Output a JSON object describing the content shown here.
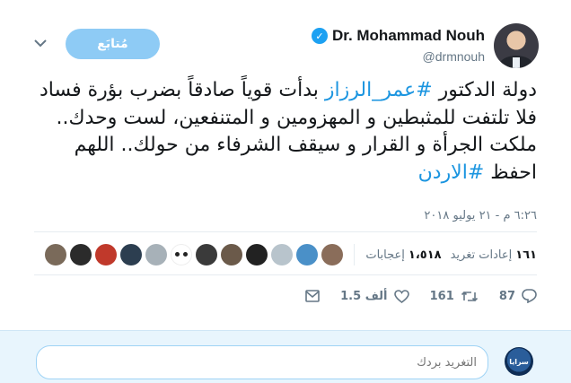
{
  "user": {
    "display_name": "Dr. Mohammad Nouh",
    "handle": "@drmnouh",
    "verified": true
  },
  "follow_button": {
    "label": "مُتابَع"
  },
  "tweet": {
    "text_parts": [
      {
        "text": "دولة الدكتور ",
        "type": "text"
      },
      {
        "text": "#عمر_الرزاز",
        "type": "hashtag"
      },
      {
        "text": " بدأت قوياً صادقاً بضرب بؤرة فساد فلا تلتفت للمثبطين و المهزومين و المتنفعين، لست وحدك.. ملكت الجرأة و القرار و سيقف الشرفاء من حولك.. اللهم احفظ ",
        "type": "text"
      },
      {
        "text": "#الاردن",
        "type": "hashtag"
      }
    ],
    "timestamp": "٦:٢٦ م - ٢١ يوليو ٢٠١٨"
  },
  "stats": {
    "retweets_count": "١٦١",
    "retweets_label": "إعادات تغريد",
    "likes_count": "١،٥١٨",
    "likes_label": "إعجابات"
  },
  "likers": [
    "#8a6d5a",
    "#4a90c8",
    "#b8c4cc",
    "#222222",
    "#6b5a4a",
    "#3a3a3a",
    "panda",
    "#a7b1b8",
    "#2c3e50",
    "#c0392b",
    "#2b2b2b",
    "#7a6a5a"
  ],
  "actions": {
    "replies": "87",
    "retweets": "161",
    "likes": "1.5 ألف"
  },
  "reply": {
    "placeholder": "التغريد بردك",
    "avatar_text": "سرايا"
  },
  "colors": {
    "link": "#1b95e0",
    "verified": "#1da1f2",
    "follow_button": "#8ecbf5",
    "reply_bg": "#e8f5fd"
  }
}
